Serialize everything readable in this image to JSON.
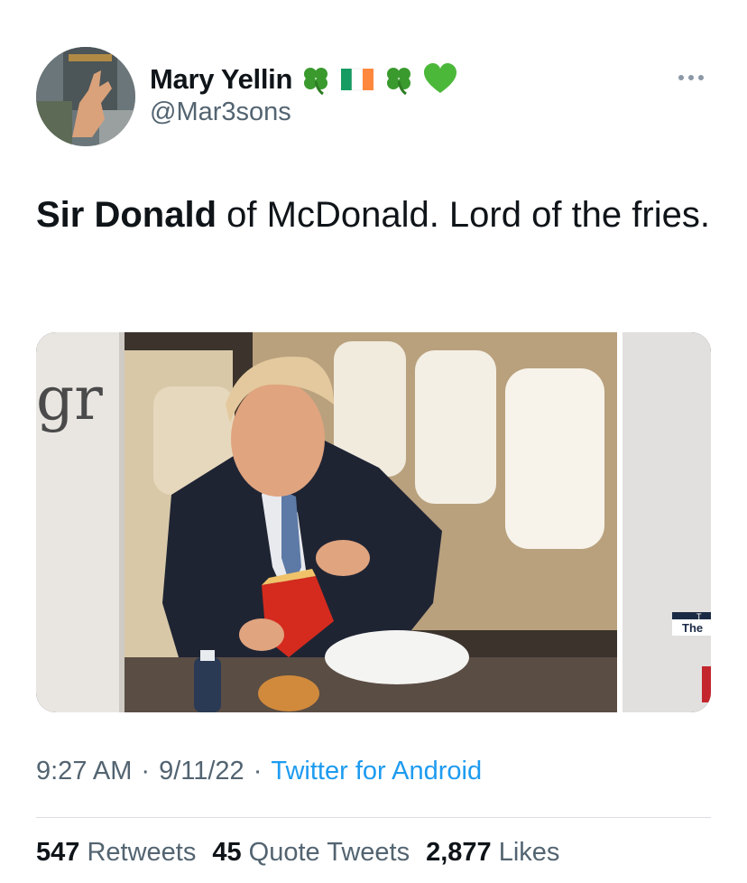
{
  "author": {
    "display_name": "Mary Yellin",
    "handle": "@Mar3sons",
    "name_emojis": [
      "shamrock-icon",
      "ireland-flag-icon",
      "shamrock-icon",
      "green-heart-icon"
    ]
  },
  "tweet": {
    "text_bold": "Sir Donald",
    "text_rest": " of McDonald. Lord of the fries."
  },
  "media": {
    "overlay_letters": "gr",
    "ticker_text": "The",
    "ticker_corner": "T"
  },
  "meta": {
    "time": "9:27 AM",
    "sep1": "·",
    "date": "9/11/22",
    "sep2": "·",
    "source": "Twitter for Android"
  },
  "stats": {
    "retweets_count": "547",
    "retweets_label": "Retweets",
    "quotes_count": "45",
    "quotes_label": "Quote Tweets",
    "likes_count": "2,877",
    "likes_label": "Likes"
  },
  "colors": {
    "link": "#1d9bf0",
    "secondary_text": "#536471",
    "primary_text": "#0f1419"
  }
}
